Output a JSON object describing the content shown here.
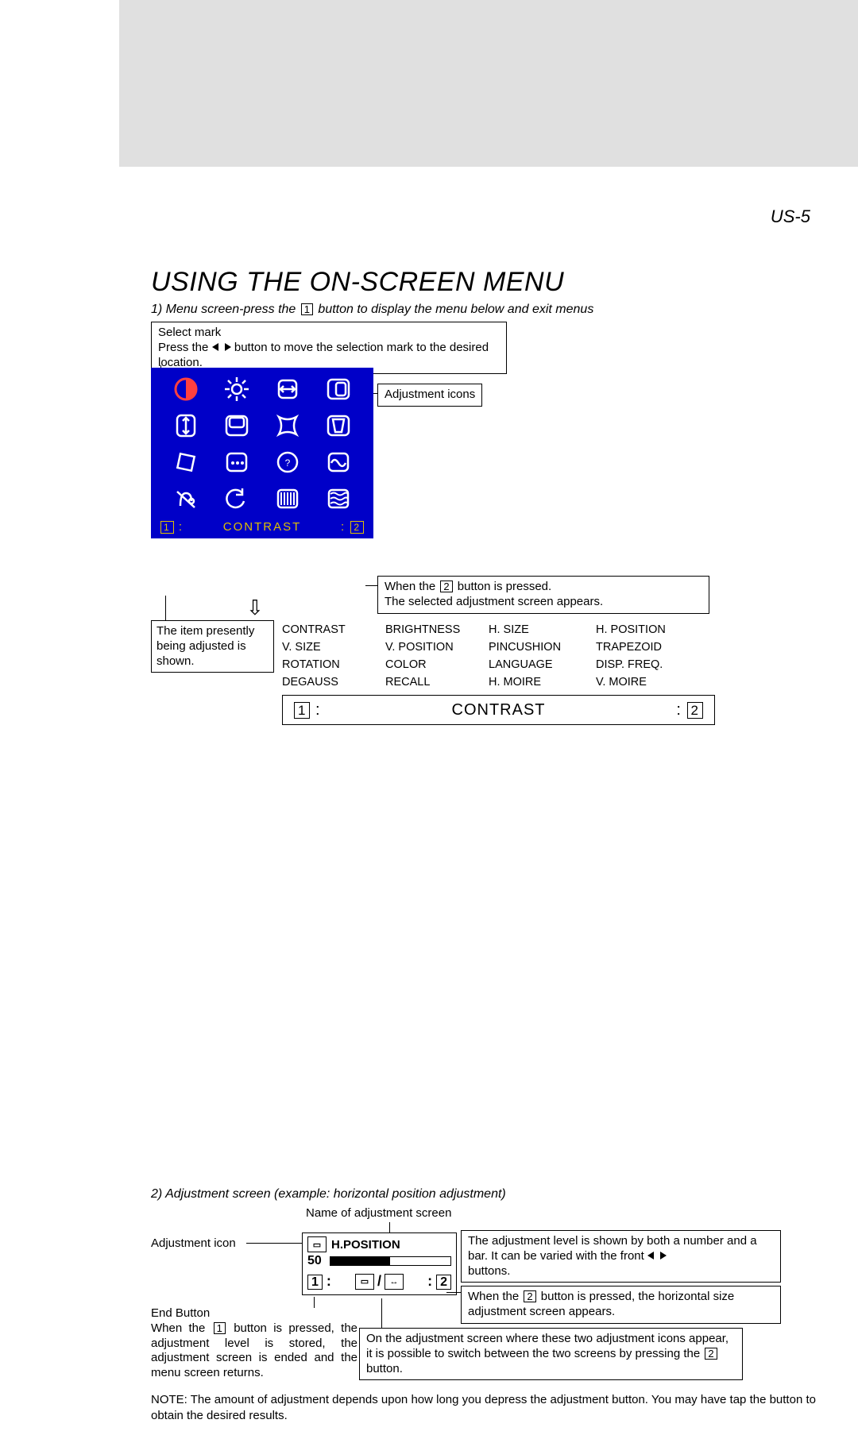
{
  "page_code": "US-5",
  "title": "USING THE ON-SCREEN MENU",
  "step1": {
    "prefix": "1) Menu screen-press the ",
    "button": "1",
    "suffix": " button to display the menu below and exit menus"
  },
  "select_mark": {
    "heading": "Select mark",
    "line_a": "Press the ",
    "line_b": " button to move the selection mark to the desired location."
  },
  "adjustment_icons_label": "Adjustment icons",
  "when2": {
    "line_a": "When the ",
    "button": "2",
    "line_b": " button is pressed.",
    "line_c": "The selected adjustment screen appears."
  },
  "osd_status": {
    "left_num": "1",
    "label": "CONTRAST",
    "right_num": "2"
  },
  "osd_icons": [
    {
      "name": "contrast-icon",
      "kind": "contrast"
    },
    {
      "name": "brightness-icon",
      "kind": "brightness"
    },
    {
      "name": "hsize-icon",
      "kind": "hsize"
    },
    {
      "name": "hposition-icon",
      "kind": "hposition"
    },
    {
      "name": "vsize-icon",
      "kind": "vsize"
    },
    {
      "name": "vposition-icon",
      "kind": "vposition"
    },
    {
      "name": "pincushion-icon",
      "kind": "pincushion"
    },
    {
      "name": "trapezoid-icon",
      "kind": "trapezoid"
    },
    {
      "name": "rotation-icon",
      "kind": "rotation"
    },
    {
      "name": "color-icon",
      "kind": "color"
    },
    {
      "name": "language-icon",
      "kind": "language"
    },
    {
      "name": "dispfreq-icon",
      "kind": "dispfreq"
    },
    {
      "name": "degauss-icon",
      "kind": "degauss"
    },
    {
      "name": "recall-icon",
      "kind": "recall"
    },
    {
      "name": "hmoire-icon",
      "kind": "hmoire"
    },
    {
      "name": "vmoire-icon",
      "kind": "vmoire"
    }
  ],
  "item_shown_label": "The item presently being adjusted is shown.",
  "labels": [
    "CONTRAST",
    "BRIGHTNESS",
    "H. SIZE",
    "H. POSITION",
    "V. SIZE",
    "V. POSITION",
    "PINCUSHION",
    "TRAPEZOID",
    "ROTATION",
    "COLOR",
    "LANGUAGE",
    "DISP. FREQ.",
    "DEGAUSS",
    "RECALL",
    "H. MOIRE",
    "V. MOIRE"
  ],
  "contrast_bar": {
    "left_num": "1",
    "colon": ":",
    "center": "CONTRAST",
    "right_colon": ":",
    "right_num": "2"
  },
  "step2_title": "2) Adjustment screen (example: horizontal position adjustment)",
  "step2_labels": {
    "name_label": "Name of adjustment screen",
    "adj_icon_label": "Adjustment icon",
    "level_a": "The adjustment level is shown by both a number and a bar. It can be varied with the front ",
    "level_b": " buttons.",
    "when2b_a": "When the ",
    "when2b_btn": "2",
    "when2b_b": " button is pressed, the horizontal size adjustment screen appears.",
    "end_a": "End Button",
    "end_b_a": "When the ",
    "end_b_btn": "1",
    "end_b_b": " button is pressed, the adjustment level is stored, the adjustment screen is ended and the menu screen returns.",
    "dual_a": "On the adjustment screen where these two adjustment icons appear, it is possible to switch between the two screens by pressing the ",
    "dual_btn": "2",
    "dual_b": " button."
  },
  "adj_panel": {
    "title": "H.POSITION",
    "value": "50",
    "left_num": "1",
    "right_num": "2"
  },
  "note_prefix": "NOTE:",
  "note_body": "The amount of adjustment depends upon how long you depress the adjustment button. You may have tap the button to obtain the desired results."
}
